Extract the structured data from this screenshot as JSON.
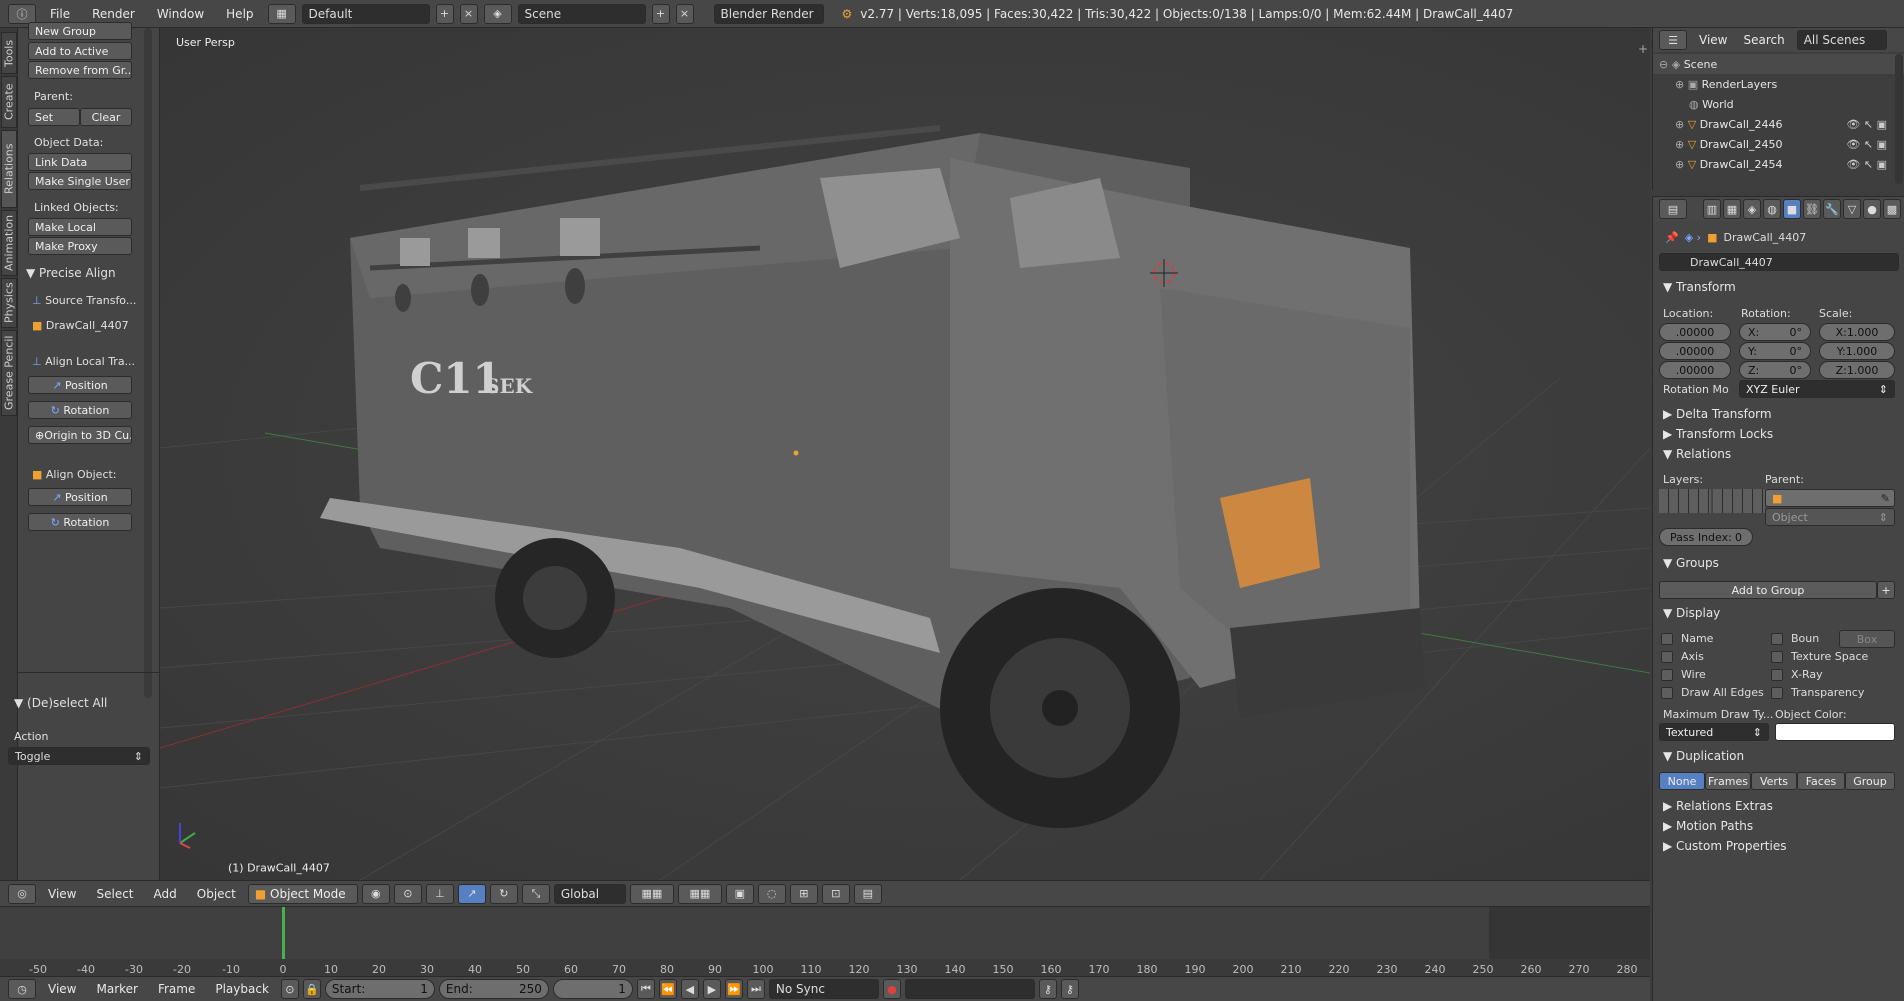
{
  "topbar": {
    "menus": [
      "File",
      "Render",
      "Window",
      "Help"
    ],
    "layout": "Default",
    "scene": "Scene",
    "engine": "Blender Render",
    "stats": "v2.77 | Verts:18,095 | Faces:30,422 | Tris:30,422 | Objects:0/138 | Lamps:0/0 | Mem:62.44M | DrawCall_4407"
  },
  "tabs": [
    "Tools",
    "Create",
    "Relations",
    "Animation",
    "Physics",
    "Grease Pencil"
  ],
  "shelf": {
    "new_group": "New Group",
    "add_to_active": "Add to Active",
    "remove_from_group": "Remove from Gr...",
    "parent_label": "Parent:",
    "set": "Set",
    "clear": "Clear",
    "object_data_label": "Object Data:",
    "link_data": "Link Data",
    "make_single_user": "Make Single User",
    "linked_objects_label": "Linked Objects:",
    "make_local": "Make Local",
    "make_proxy": "Make Proxy",
    "precise_align": "Precise Align",
    "source_transform": "Source Transfo...",
    "drawcall": "DrawCall_4407",
    "align_local": "Align Local Tra...",
    "position": "Position",
    "rotation": "Rotation",
    "origin_3d": "Origin to 3D Cu...",
    "align_object": "Align Object:",
    "position2": "Position",
    "rotation2": "Rotation",
    "deselect_all": "(De)select All",
    "action_label": "Action",
    "action_value": "Toggle"
  },
  "viewport": {
    "persp_label": "User Persp",
    "object_label": "(1) DrawCall_4407",
    "decal_main": "C11",
    "decal_sub": "SEK"
  },
  "vp_header": {
    "view": "View",
    "select": "Select",
    "add": "Add",
    "object": "Object",
    "mode": "Object Mode",
    "orientation": "Global"
  },
  "timeline": {
    "ticks": [
      "-50",
      "-40",
      "-30",
      "-20",
      "-10",
      "0",
      "10",
      "20",
      "30",
      "40",
      "50",
      "60",
      "70",
      "80",
      "90",
      "100",
      "110",
      "120",
      "130",
      "140",
      "150",
      "160",
      "170",
      "180",
      "190",
      "200",
      "210",
      "220",
      "230",
      "240",
      "250",
      "260",
      "270",
      "280"
    ]
  },
  "tl_header": {
    "view": "View",
    "marker": "Marker",
    "frame": "Frame",
    "playback": "Playback",
    "start": "Start:",
    "start_val": "1",
    "end": "End:",
    "end_val": "250",
    "current": "1",
    "sync": "No Sync"
  },
  "outliner": {
    "view": "View",
    "search": "Search",
    "filter": "All Scenes",
    "items": [
      "Scene",
      "RenderLayers",
      "World",
      "DrawCall_2446",
      "DrawCall_2450",
      "DrawCall_2454"
    ]
  },
  "props": {
    "object_path": "DrawCall_4407",
    "object_name": "DrawCall_4407",
    "transform": "Transform",
    "location": "Location:",
    "rotation": "Rotation:",
    "scale": "Scale:",
    "loc": [
      ".00000",
      ".00000",
      ".00000"
    ],
    "rot": [
      "X:",
      "0°",
      "Y:",
      "0°",
      "Z:",
      "0°"
    ],
    "scl": [
      "X:1.000",
      "Y:1.000",
      "Z:1.000"
    ],
    "rotation_mode_label": "Rotation Mo",
    "rotation_mode": "XYZ Euler",
    "delta_transform": "Delta Transform",
    "transform_locks": "Transform Locks",
    "relations": "Relations",
    "layers": "Layers:",
    "parent": "Parent:",
    "parent_type": "Object",
    "pass_index": "Pass Index:",
    "pass_index_val": "0",
    "groups": "Groups",
    "add_to_group": "Add to Group",
    "display": "Display",
    "name": "Name",
    "bounds": "Boun",
    "bounds_type": "Box",
    "axis": "Axis",
    "texture_space": "Texture Space",
    "wire": "Wire",
    "xray": "X-Ray",
    "draw_all_edges": "Draw All Edges",
    "transparency": "Transparency",
    "max_draw_type": "Maximum Draw Ty...",
    "object_color": "Object Color:",
    "draw_type_val": "Textured",
    "duplication": "Duplication",
    "dup_none": "None",
    "dup_frames": "Frames",
    "dup_verts": "Verts",
    "dup_faces": "Faces",
    "dup_group": "Group",
    "relations_extras": "Relations Extras",
    "motion_paths": "Motion Paths",
    "custom_properties": "Custom Properties"
  },
  "colors": {
    "accent_blue": "#5680c2",
    "background": "#3d3d3d"
  }
}
